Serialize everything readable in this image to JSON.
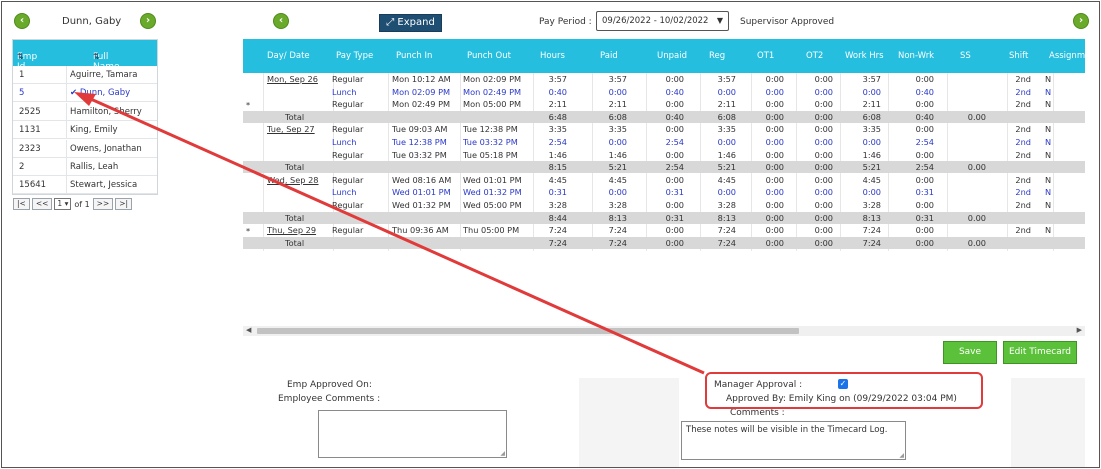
{
  "employee_panel": {
    "current_employee": "Dunn, Gaby",
    "col_emp_id": "Emp Id",
    "col_full_name": "Full Name",
    "rows": [
      {
        "id": "1",
        "name": "Aguirre, Tamara",
        "selected": false
      },
      {
        "id": "5",
        "name": "Dunn, Gaby",
        "selected": true
      },
      {
        "id": "2525",
        "name": "Hamilton, Sherry",
        "selected": false
      },
      {
        "id": "1131",
        "name": "King, Emily",
        "selected": false
      },
      {
        "id": "2323",
        "name": "Owens, Jonathan",
        "selected": false
      },
      {
        "id": "2",
        "name": "Rallis, Leah",
        "selected": false
      },
      {
        "id": "15641",
        "name": "Stewart, Jessica",
        "selected": false
      }
    ],
    "pager": {
      "first": "|<",
      "prev": "<<",
      "page": "1",
      "of_text": "of 1",
      "next": ">>",
      "last": ">|"
    }
  },
  "toolbar": {
    "expand_label": "Expand",
    "pay_period_label": "Pay Period :",
    "pay_period_value": "09/26/2022 - 10/02/2022",
    "status": "Supervisor Approved"
  },
  "grid": {
    "columns": [
      "Day/ Date",
      "Pay Type",
      "Punch In",
      "Punch Out",
      "Hours",
      "Paid",
      "Unpaid",
      "Reg",
      "OT1",
      "OT2",
      "Work Hrs",
      "Non-Wrk",
      "SS",
      "Shift",
      "Assignme"
    ],
    "rows": [
      {
        "day": "Mon, Sep 26",
        "pay_type": "Regular",
        "in": "Mon 10:12 AM",
        "out": "Mon 02:09 PM",
        "hours": "3:57",
        "paid": "3:57",
        "unpaid": "0:00",
        "reg": "3:57",
        "ot1": "0:00",
        "ot2": "0:00",
        "work": "3:57",
        "nonwork": "0:00",
        "ss": "",
        "shift": "2nd",
        "assign": "N",
        "kind": "regular",
        "marker": ""
      },
      {
        "day": "",
        "pay_type": "Lunch",
        "in": "Mon 02:09 PM",
        "out": "Mon 02:49 PM",
        "hours": "0:40",
        "paid": "0:00",
        "unpaid": "0:40",
        "reg": "0:00",
        "ot1": "0:00",
        "ot2": "0:00",
        "work": "0:00",
        "nonwork": "0:40",
        "ss": "",
        "shift": "2nd",
        "assign": "N",
        "kind": "lunch",
        "marker": ""
      },
      {
        "day": "",
        "pay_type": "Regular",
        "in": "Mon 02:49 PM",
        "out": "Mon 05:00 PM",
        "hours": "2:11",
        "paid": "2:11",
        "unpaid": "0:00",
        "reg": "2:11",
        "ot1": "0:00",
        "ot2": "0:00",
        "work": "2:11",
        "nonwork": "0:00",
        "ss": "",
        "shift": "2nd",
        "assign": "N",
        "kind": "regular",
        "marker": "*"
      },
      {
        "day": "Total",
        "pay_type": "",
        "in": "",
        "out": "",
        "hours": "6:48",
        "paid": "6:08",
        "unpaid": "0:40",
        "reg": "6:08",
        "ot1": "0:00",
        "ot2": "0:00",
        "work": "6:08",
        "nonwork": "0:40",
        "ss": "0.00",
        "shift": "",
        "assign": "",
        "kind": "total",
        "marker": ""
      },
      {
        "day": "Tue, Sep 27",
        "pay_type": "Regular",
        "in": "Tue 09:03 AM",
        "out": "Tue 12:38 PM",
        "hours": "3:35",
        "paid": "3:35",
        "unpaid": "0:00",
        "reg": "3:35",
        "ot1": "0:00",
        "ot2": "0:00",
        "work": "3:35",
        "nonwork": "0:00",
        "ss": "",
        "shift": "2nd",
        "assign": "N",
        "kind": "regular",
        "marker": ""
      },
      {
        "day": "",
        "pay_type": "Lunch",
        "in": "Tue 12:38 PM",
        "out": "Tue 03:32 PM",
        "hours": "2:54",
        "paid": "0:00",
        "unpaid": "2:54",
        "reg": "0:00",
        "ot1": "0:00",
        "ot2": "0:00",
        "work": "0:00",
        "nonwork": "2:54",
        "ss": "",
        "shift": "2nd",
        "assign": "N",
        "kind": "lunch",
        "marker": ""
      },
      {
        "day": "",
        "pay_type": "Regular",
        "in": "Tue 03:32 PM",
        "out": "Tue 05:18 PM",
        "hours": "1:46",
        "paid": "1:46",
        "unpaid": "0:00",
        "reg": "1:46",
        "ot1": "0:00",
        "ot2": "0:00",
        "work": "1:46",
        "nonwork": "0:00",
        "ss": "",
        "shift": "2nd",
        "assign": "N",
        "kind": "regular",
        "marker": ""
      },
      {
        "day": "Total",
        "pay_type": "",
        "in": "",
        "out": "",
        "hours": "8:15",
        "paid": "5:21",
        "unpaid": "2:54",
        "reg": "5:21",
        "ot1": "0:00",
        "ot2": "0:00",
        "work": "5:21",
        "nonwork": "2:54",
        "ss": "0.00",
        "shift": "",
        "assign": "",
        "kind": "total",
        "marker": ""
      },
      {
        "day": "Wed, Sep 28",
        "pay_type": "Regular",
        "in": "Wed 08:16 AM",
        "out": "Wed 01:01 PM",
        "hours": "4:45",
        "paid": "4:45",
        "unpaid": "0:00",
        "reg": "4:45",
        "ot1": "0:00",
        "ot2": "0:00",
        "work": "4:45",
        "nonwork": "0:00",
        "ss": "",
        "shift": "2nd",
        "assign": "N",
        "kind": "regular",
        "marker": ""
      },
      {
        "day": "",
        "pay_type": "Lunch",
        "in": "Wed 01:01 PM",
        "out": "Wed 01:32 PM",
        "hours": "0:31",
        "paid": "0:00",
        "unpaid": "0:31",
        "reg": "0:00",
        "ot1": "0:00",
        "ot2": "0:00",
        "work": "0:00",
        "nonwork": "0:31",
        "ss": "",
        "shift": "2nd",
        "assign": "N",
        "kind": "lunch",
        "marker": ""
      },
      {
        "day": "",
        "pay_type": "Regular",
        "in": "Wed 01:32 PM",
        "out": "Wed 05:00 PM",
        "hours": "3:28",
        "paid": "3:28",
        "unpaid": "0:00",
        "reg": "3:28",
        "ot1": "0:00",
        "ot2": "0:00",
        "work": "3:28",
        "nonwork": "0:00",
        "ss": "",
        "shift": "2nd",
        "assign": "N",
        "kind": "regular",
        "marker": ""
      },
      {
        "day": "Total",
        "pay_type": "",
        "in": "",
        "out": "",
        "hours": "8:44",
        "paid": "8:13",
        "unpaid": "0:31",
        "reg": "8:13",
        "ot1": "0:00",
        "ot2": "0:00",
        "work": "8:13",
        "nonwork": "0:31",
        "ss": "0.00",
        "shift": "",
        "assign": "",
        "kind": "total",
        "marker": ""
      },
      {
        "day": "Thu, Sep 29",
        "pay_type": "Regular",
        "in": "Thu 09:36 AM",
        "out": "Thu 05:00 PM",
        "hours": "7:24",
        "paid": "7:24",
        "unpaid": "0:00",
        "reg": "7:24",
        "ot1": "0:00",
        "ot2": "0:00",
        "work": "7:24",
        "nonwork": "0:00",
        "ss": "",
        "shift": "2nd",
        "assign": "N",
        "kind": "regular",
        "marker": "*"
      },
      {
        "day": "Total",
        "pay_type": "",
        "in": "",
        "out": "",
        "hours": "7:24",
        "paid": "7:24",
        "unpaid": "0:00",
        "reg": "7:24",
        "ot1": "0:00",
        "ot2": "0:00",
        "work": "7:24",
        "nonwork": "0:00",
        "ss": "0.00",
        "shift": "",
        "assign": "",
        "kind": "total",
        "marker": ""
      }
    ]
  },
  "actions": {
    "save": "Save",
    "edit_timecard": "Edit Timecard"
  },
  "approval": {
    "emp_approved_on_label": "Emp Approved On:",
    "employee_comments_label": "Employee Comments :",
    "manager_approval_label": "Manager Approval :",
    "manager_approved": true,
    "approved_by": "Approved By: Emily King on (09/29/2022 03:04 PM)",
    "comments_label": "Comments :",
    "comments_text": "These notes will be visible in the Timecard Log."
  },
  "colors": {
    "accent": "#25bede",
    "nav_green": "#6aaa2a",
    "lunch": "#2a39c9",
    "annotation": "#e03a3a"
  }
}
